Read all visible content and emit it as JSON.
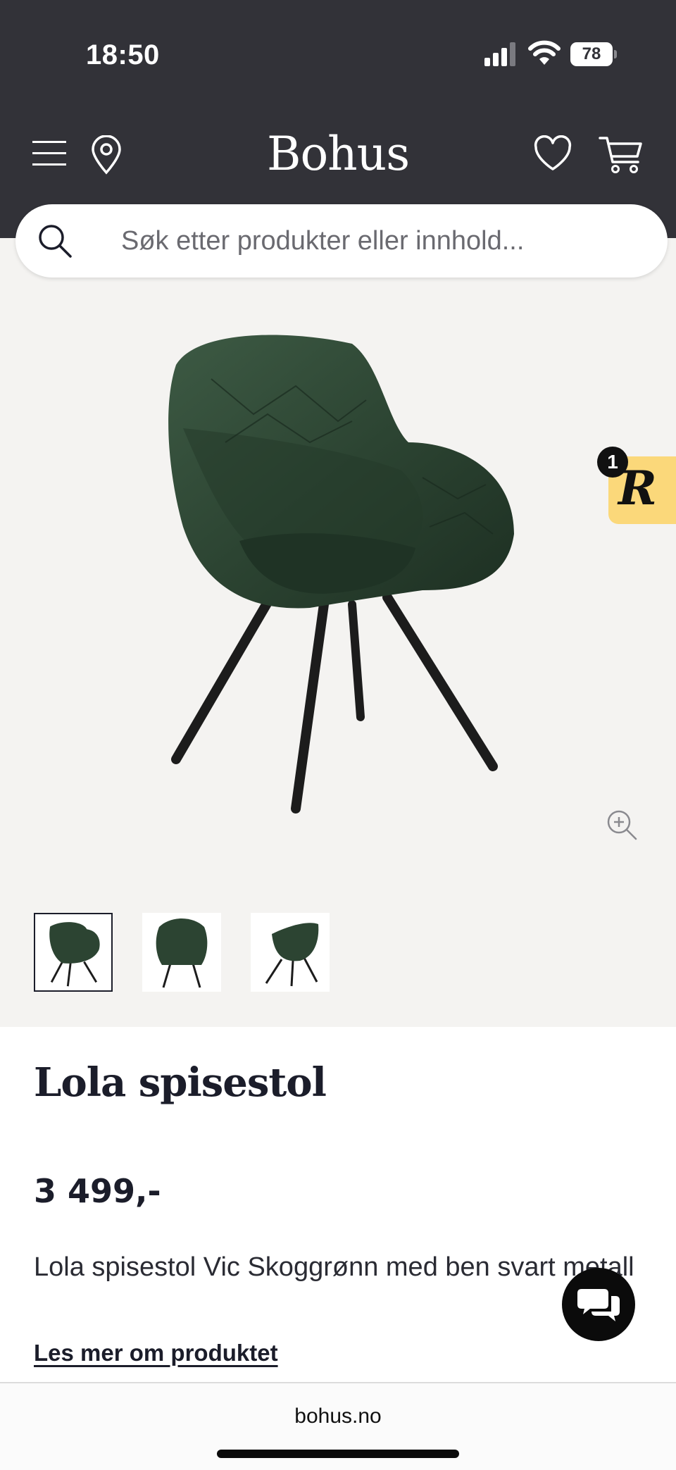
{
  "status_bar": {
    "time": "18:50",
    "battery": "78"
  },
  "header": {
    "logo": "Bohus"
  },
  "search": {
    "placeholder": "Søk etter produkter eller innhold..."
  },
  "badge": {
    "letter": "R",
    "count": "1"
  },
  "product": {
    "title": "Lola spisestol",
    "price": "3 499,-",
    "description": "Lola spisestol Vic Skoggrønn med ben svart metall",
    "read_more": "Les mer om produktet"
  },
  "thumbnails": {
    "count": 3,
    "selected_index": 0
  },
  "browser": {
    "url": "bohus.no"
  },
  "colors": {
    "header_bg": "#323238",
    "gallery_bg": "#f4f3f1",
    "chair_green": "#2c4432",
    "badge_yellow": "#fbd87a"
  }
}
